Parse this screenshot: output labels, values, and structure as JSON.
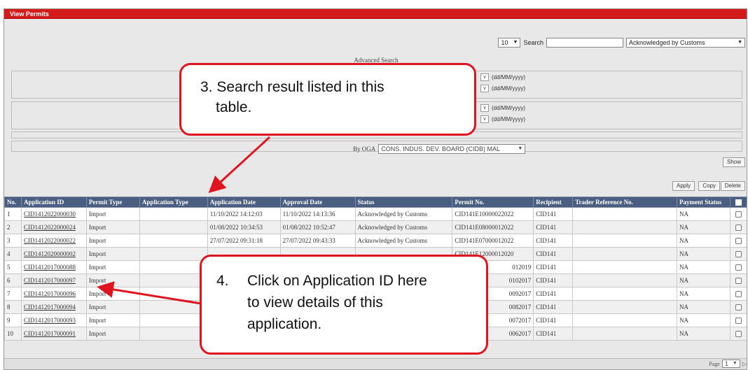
{
  "window": {
    "title": "View Permits"
  },
  "toolbar": {
    "page_size": "10",
    "search_label": "Search",
    "search_value": "",
    "status_filter": "Acknowledged by Customs"
  },
  "advanced": {
    "title": "Advanced Search",
    "date_format": "(dd/MM/yyyy)",
    "date_btn": "v",
    "oga_label": "By OGA",
    "oga_value": "CONS. INDUS. DEV. BOARD (CIDB) MAL"
  },
  "buttons": {
    "show": "Show",
    "apply": "Apply",
    "copy": "Copy",
    "delete": "Delete"
  },
  "table": {
    "headers": [
      "No.",
      "Application ID",
      "Permit Type",
      "Application Type",
      "Application Date",
      "Approval Date",
      "Status",
      "Permit No.",
      "Recipient",
      "Trader Reference No.",
      "Payment Status"
    ],
    "rows": [
      {
        "no": "1",
        "app_id": "CID1412022000030",
        "permit_type": "Import",
        "app_type": "",
        "app_date": "11/10/2022 14:12:03",
        "approval_date": "11/10/2022 14:13:36",
        "status": "Acknowledged by Customs",
        "permit_no": "CID141E10000022022",
        "recipient": "CID141",
        "trader_ref": "",
        "payment": "NA"
      },
      {
        "no": "2",
        "app_id": "CID1412022000024",
        "permit_type": "Import",
        "app_type": "",
        "app_date": "01/08/2022 10:34:53",
        "approval_date": "01/08/2022 10:52:47",
        "status": "Acknowledged by Customs",
        "permit_no": "CID141E08000012022",
        "recipient": "CID141",
        "trader_ref": "",
        "payment": "NA"
      },
      {
        "no": "3",
        "app_id": "CID1412022000022",
        "permit_type": "Import",
        "app_type": "",
        "app_date": "27/07/2022 09:31:18",
        "approval_date": "27/07/2022 09:43:33",
        "status": "Acknowledged by Customs",
        "permit_no": "CID141E07000012022",
        "recipient": "CID141",
        "trader_ref": "",
        "payment": "NA"
      },
      {
        "no": "4",
        "app_id": "CID1412020000002",
        "permit_type": "Import",
        "app_type": "",
        "app_date": "",
        "approval_date": "",
        "status": "",
        "permit_no": "CID141E12000012020",
        "recipient": "CID141",
        "trader_ref": "",
        "payment": "NA"
      },
      {
        "no": "5",
        "app_id": "CID1412017000088",
        "permit_type": "Import",
        "app_type": "",
        "app_date": "",
        "approval_date": "",
        "status": "",
        "permit_no": "012019",
        "recipient": "CID141",
        "trader_ref": "",
        "payment": "NA"
      },
      {
        "no": "6",
        "app_id": "CID1412017000097",
        "permit_type": "Import",
        "app_type": "",
        "app_date": "",
        "approval_date": "",
        "status": "",
        "permit_no": "0102017",
        "recipient": "CID141",
        "trader_ref": "",
        "payment": "NA"
      },
      {
        "no": "7",
        "app_id": "CID1412017000096",
        "permit_type": "Import",
        "app_type": "",
        "app_date": "",
        "approval_date": "",
        "status": "",
        "permit_no": "0092017",
        "recipient": "CID141",
        "trader_ref": "",
        "payment": "NA"
      },
      {
        "no": "8",
        "app_id": "CID1412017000094",
        "permit_type": "Import",
        "app_type": "",
        "app_date": "",
        "approval_date": "",
        "status": "",
        "permit_no": "0082017",
        "recipient": "CID141",
        "trader_ref": "",
        "payment": "NA"
      },
      {
        "no": "9",
        "app_id": "CID1412017000093",
        "permit_type": "Import",
        "app_type": "",
        "app_date": "",
        "approval_date": "",
        "status": "",
        "permit_no": "0072017",
        "recipient": "CID141",
        "trader_ref": "",
        "payment": "NA"
      },
      {
        "no": "10",
        "app_id": "CID1412017000091",
        "permit_type": "Import",
        "app_type": "",
        "app_date": "",
        "approval_date": "",
        "status": "",
        "permit_no": "0062017",
        "recipient": "CID141",
        "trader_ref": "",
        "payment": "NA"
      }
    ]
  },
  "pager": {
    "label": "Page",
    "value": "1"
  },
  "callouts": {
    "step3_line1": "3. Search result listed in this",
    "step3_line2": "table.",
    "step4_num": "4.",
    "step4_line1": "Click on Application ID here",
    "step4_line2": "to view details of this",
    "step4_line3": "application."
  },
  "colors": {
    "titlebar": "#d41b1b",
    "table_header": "#4a5e82",
    "callout_border": "#e0141e",
    "link": "#1a2fa8"
  }
}
